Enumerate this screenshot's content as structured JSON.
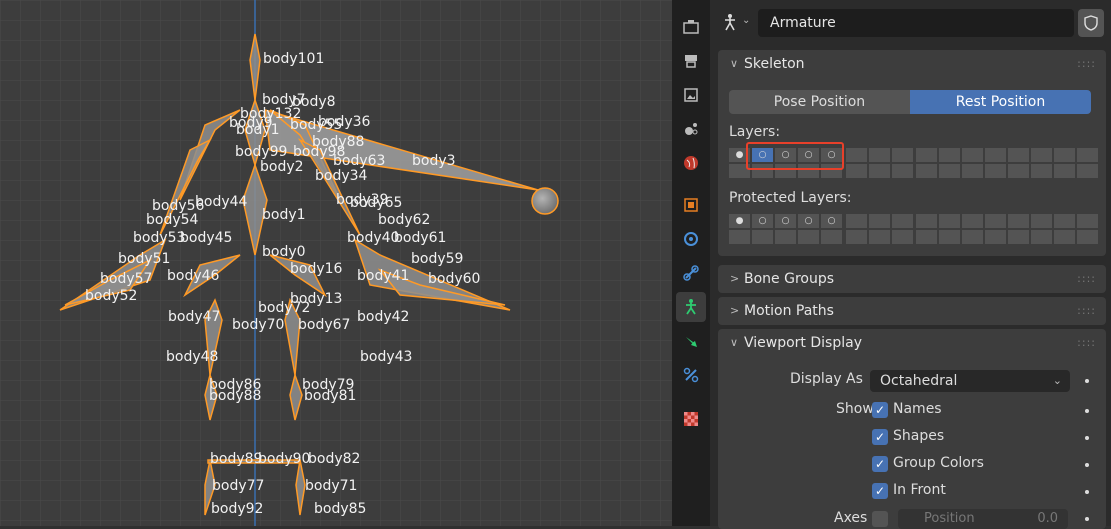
{
  "viewport": {
    "bones": [
      "body101",
      "body7",
      "body8",
      "body132",
      "body9",
      "body1",
      "body55",
      "body36",
      "body88",
      "body99",
      "body98",
      "body3",
      "body63",
      "body34",
      "body2",
      "body44",
      "body56",
      "body39",
      "body65",
      "body54",
      "body62",
      "body1",
      "body53",
      "body45",
      "body40",
      "body61",
      "body51",
      "body0",
      "body59",
      "body57",
      "body46",
      "body16",
      "body41",
      "body60",
      "body52",
      "body13",
      "body47",
      "body72",
      "body70",
      "body67",
      "body42",
      "body48",
      "body43",
      "body86",
      "body88",
      "body79",
      "body81",
      "body89",
      "body90",
      "body82",
      "body77",
      "body71",
      "body92",
      "body85"
    ]
  },
  "properties": {
    "header": {
      "name": "Armature"
    },
    "skeleton": {
      "title": "Skeleton",
      "pose_position": "Pose Position",
      "rest_position": "Rest Position",
      "layers_label": "Layers:",
      "protected_layers_label": "Protected Layers:"
    },
    "bone_groups": {
      "title": "Bone Groups"
    },
    "motion_paths": {
      "title": "Motion Paths"
    },
    "viewport_display": {
      "title": "Viewport Display",
      "display_as_label": "Display As",
      "display_as_value": "Octahedral",
      "show_label": "Show",
      "names": "Names",
      "shapes": "Shapes",
      "group_colors": "Group Colors",
      "in_front": "In Front",
      "axes_label": "Axes",
      "position_label": "Position",
      "position_value": "0.0"
    },
    "colors": {
      "accent": "#4772b3",
      "highlight": "#e8402a",
      "bone_orange": "#ffa033"
    }
  }
}
